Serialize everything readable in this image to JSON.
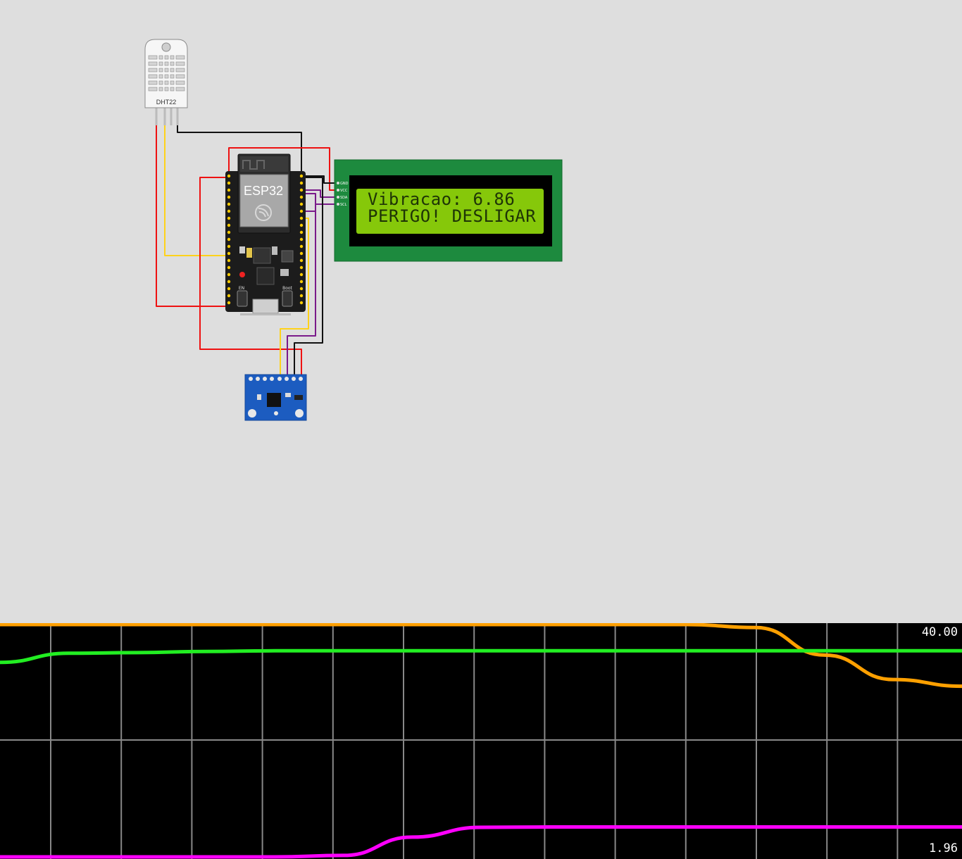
{
  "dht22": {
    "label": "DHT22"
  },
  "esp32": {
    "label": "ESP32",
    "en_label": "EN",
    "boot_label": "Boot"
  },
  "lcd": {
    "line1": "Vibracao: 6.86",
    "line2": "PERIGO! DESLIGAR",
    "pins": [
      "GND",
      "VCC",
      "SDA",
      "SCL"
    ]
  },
  "plotter": {
    "y_max_label": "40.00",
    "y_min_label": "1.96",
    "series_colors": [
      "#ffa000",
      "#22ee22",
      "#ff00ff"
    ]
  },
  "chart_data": {
    "type": "line",
    "ylim": [
      1.96,
      40.0
    ],
    "grid": true,
    "series": [
      {
        "color": "#ffa000",
        "values": [
          40,
          40,
          40,
          40,
          40,
          40,
          40,
          40,
          40,
          40,
          40,
          39.5,
          35,
          31,
          29.9
        ]
      },
      {
        "color": "#22ee22",
        "values": [
          33.8,
          35.3,
          35.4,
          35.6,
          35.7,
          35.7,
          35.7,
          35.7,
          35.7,
          35.7,
          35.7,
          35.7,
          35.7,
          35.7,
          35.7
        ]
      },
      {
        "color": "#ff00ff",
        "values": [
          1.96,
          1.96,
          1.96,
          1.96,
          1.96,
          2.2,
          5.2,
          6.8,
          6.86,
          6.86,
          6.86,
          6.86,
          6.86,
          6.86,
          6.86
        ]
      }
    ]
  }
}
